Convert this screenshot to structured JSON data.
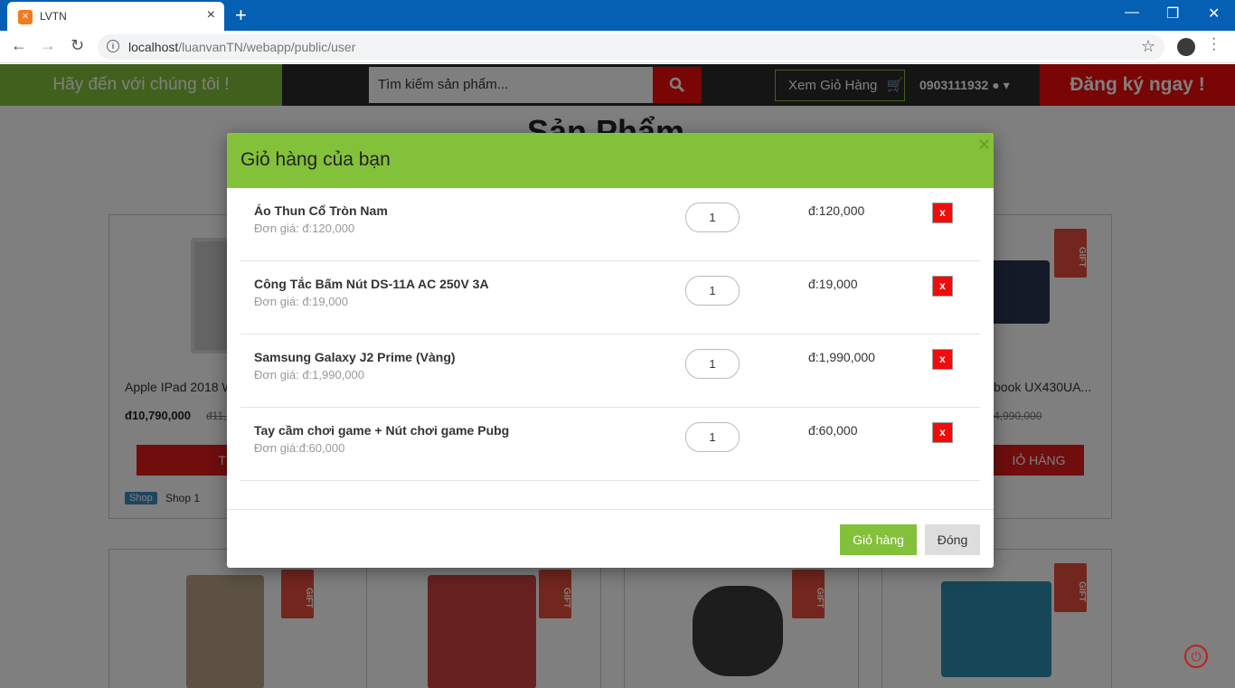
{
  "browser": {
    "tab_title": "LVTN",
    "url_host": "localhost",
    "url_path": "/luanvanTN/webapp/public/user"
  },
  "header": {
    "welcome": "Hãy đến với chúng tôi !",
    "search_placeholder": "Tìm kiếm sản phẩm...",
    "view_cart": "Xem Giỏ Hàng",
    "phone": "0903111932",
    "register": "Đăng ký ngay !"
  },
  "page": {
    "section_title": "Sản Phẩm",
    "cards": [
      {
        "name": "Apple IPad 2018 W",
        "price": "đ10,790,000",
        "old_price": "đ11,",
        "button": "THÊM GIO",
        "shop_badge": "Shop",
        "shop": "Shop 1"
      },
      {
        "name": "book UX430UA...",
        "old_price": "4,990,000",
        "button": "IỎ HÀNG"
      }
    ],
    "gift_label": "GIFT"
  },
  "modal": {
    "title": "Giỏ hàng của bạn",
    "close_x": "×",
    "items": [
      {
        "name": "Áo Thun Cổ Tròn Nam",
        "unit": "Đơn giá: đ:120,000",
        "qty": "1",
        "total": "đ:120,000",
        "remove": "x"
      },
      {
        "name": "Công Tắc Bấm Nút DS-11A AC 250V 3A",
        "unit": "Đơn giá: đ:19,000",
        "qty": "1",
        "total": "đ:19,000",
        "remove": "x"
      },
      {
        "name": "Samsung Galaxy J2 Prime (Vàng)",
        "unit": "Đơn giá: đ:1,990,000",
        "qty": "1",
        "total": "đ:1,990,000",
        "remove": "x"
      },
      {
        "name": "Tay cầm chơi game + Nút chơi game Pubg",
        "unit": "Đơn giá:đ:60,000",
        "qty": "1",
        "total": "đ:60,000",
        "remove": "x"
      }
    ],
    "cart_button": "Giỏ hàng",
    "close_button": "Đóng"
  },
  "colors": {
    "brand_green": "#84c13a",
    "brand_red": "#f20b0b",
    "browser_blue": "#0560b4"
  }
}
